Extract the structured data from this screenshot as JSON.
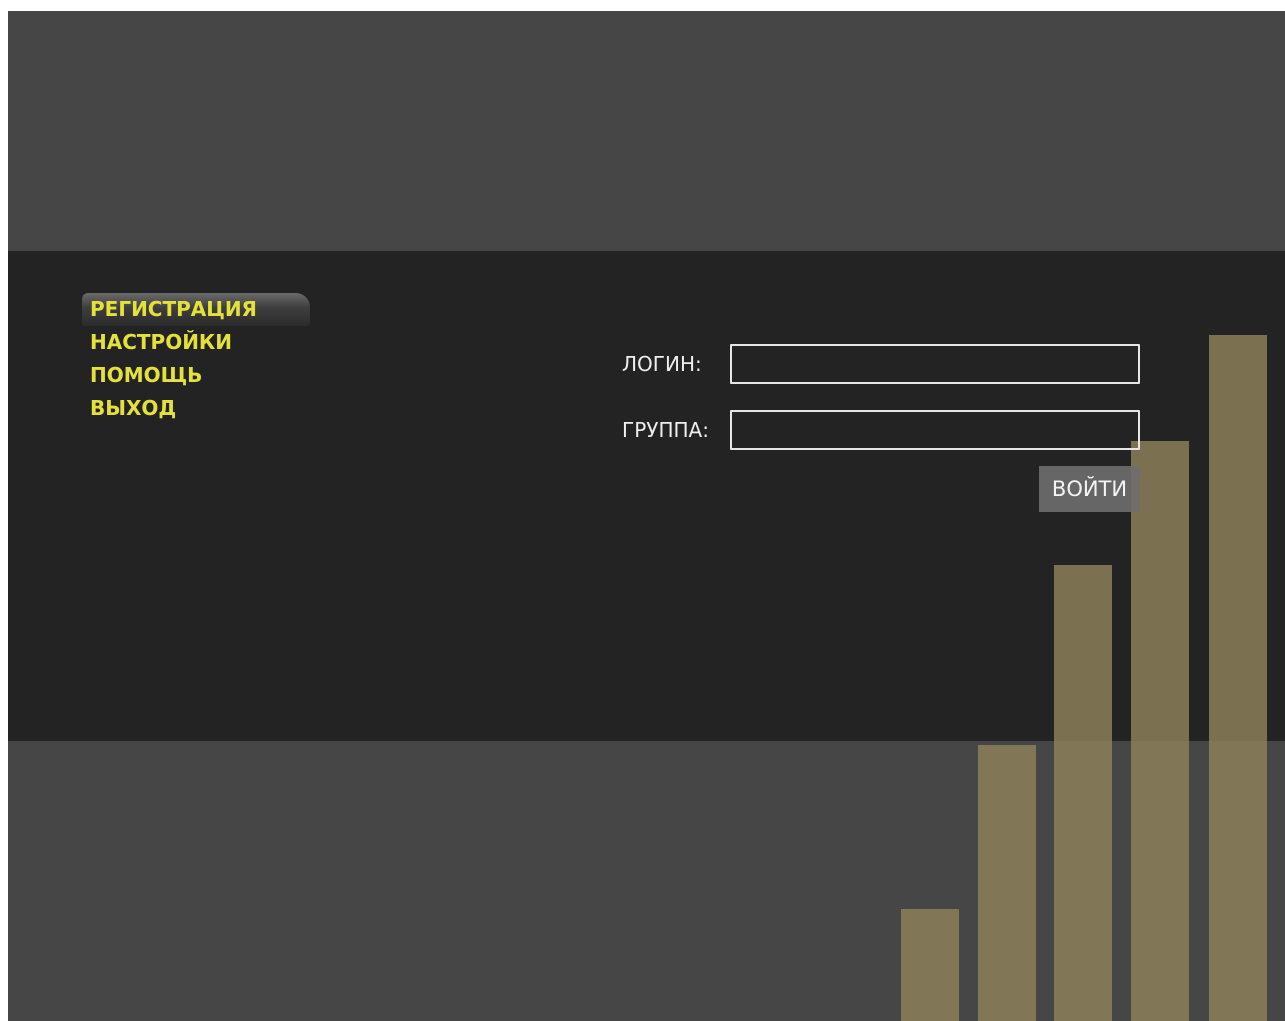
{
  "menu": {
    "items": [
      {
        "label": "РЕГИСТРАЦИЯ",
        "active": true
      },
      {
        "label": "НАСТРОЙКИ",
        "active": false
      },
      {
        "label": "ПОМОЩЬ",
        "active": false
      },
      {
        "label": "ВЫХОД",
        "active": false
      }
    ]
  },
  "form": {
    "login_label": "ЛОГИН:",
    "login_value": "",
    "group_label": "ГРУППА:",
    "group_value": "",
    "submit_label": "ВОЙТИ"
  },
  "colors": {
    "menu_text": "#e4e23a",
    "band_light": "#464646",
    "band_dark": "#232323",
    "bar": "#8f825a"
  }
}
